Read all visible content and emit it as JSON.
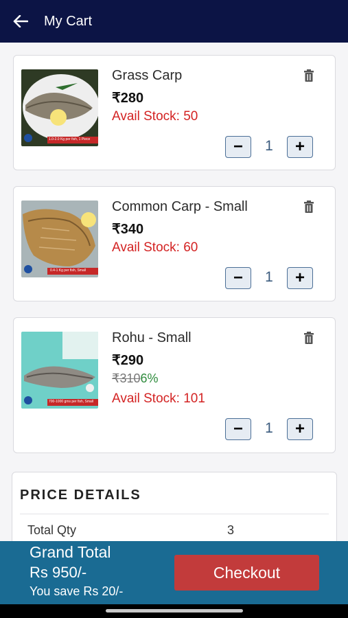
{
  "appbar": {
    "title": "My Cart"
  },
  "items": [
    {
      "name": "Grass Carp",
      "price": "₹280",
      "stock": "Avail Stock: 50",
      "qty": "1",
      "badge": "1.0-2.0 Kg per fish, 1 Piece"
    },
    {
      "name": "Common Carp - Small",
      "price": "₹340",
      "stock": "Avail Stock: 60",
      "qty": "1",
      "badge": "0.4-1 Kg per fish, Small"
    },
    {
      "name": "Rohu - Small",
      "price": "₹290",
      "mrp": "₹310",
      "discount": "6%",
      "stock": "Avail Stock: 101",
      "qty": "1",
      "badge": "700-1000 gms per fish, Small"
    }
  ],
  "stepper": {
    "minus": "−",
    "plus": "+"
  },
  "price_details": {
    "title": "PRICE DETAILS",
    "rows": [
      {
        "label": "Total Qty",
        "value": "3"
      }
    ]
  },
  "footer": {
    "grand_total_label": "Grand Total",
    "grand_total_value": "Rs 950/-",
    "savings": "You save Rs 20/-",
    "checkout_label": "Checkout"
  },
  "colors": {
    "appbar": "#0c1445",
    "footer": "#1a6b93",
    "checkout": "#c23b3b",
    "stock": "#d32222",
    "discount": "#2e8b3c"
  }
}
